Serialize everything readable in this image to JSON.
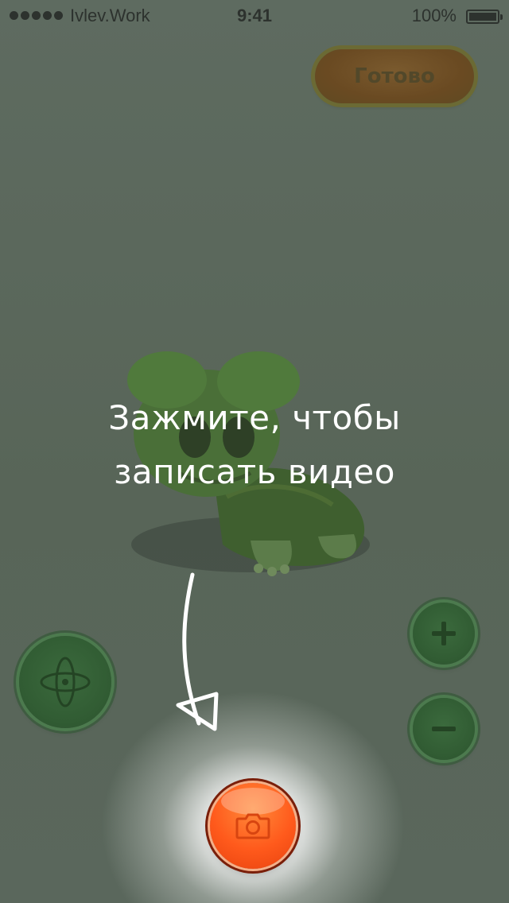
{
  "status_bar": {
    "carrier": "Ivlev.Work",
    "time": "9:41",
    "battery_percent": "100%",
    "battery_level": 1.0,
    "signal_bars": 5
  },
  "toolbar": {
    "done_label": "Готово"
  },
  "hint": {
    "text": "Зажмите, чтобы\nзаписать видео"
  },
  "controls": {
    "rotate_icon": "rotate-3d-icon",
    "zoom_in_icon": "plus-icon",
    "zoom_out_icon": "minus-icon",
    "record_icon": "camera-icon"
  },
  "colors": {
    "overlay": "#5d6a5f",
    "record_accent": "#ff5a1c",
    "control_green": "#315c33",
    "hint_text": "#ffffff"
  }
}
